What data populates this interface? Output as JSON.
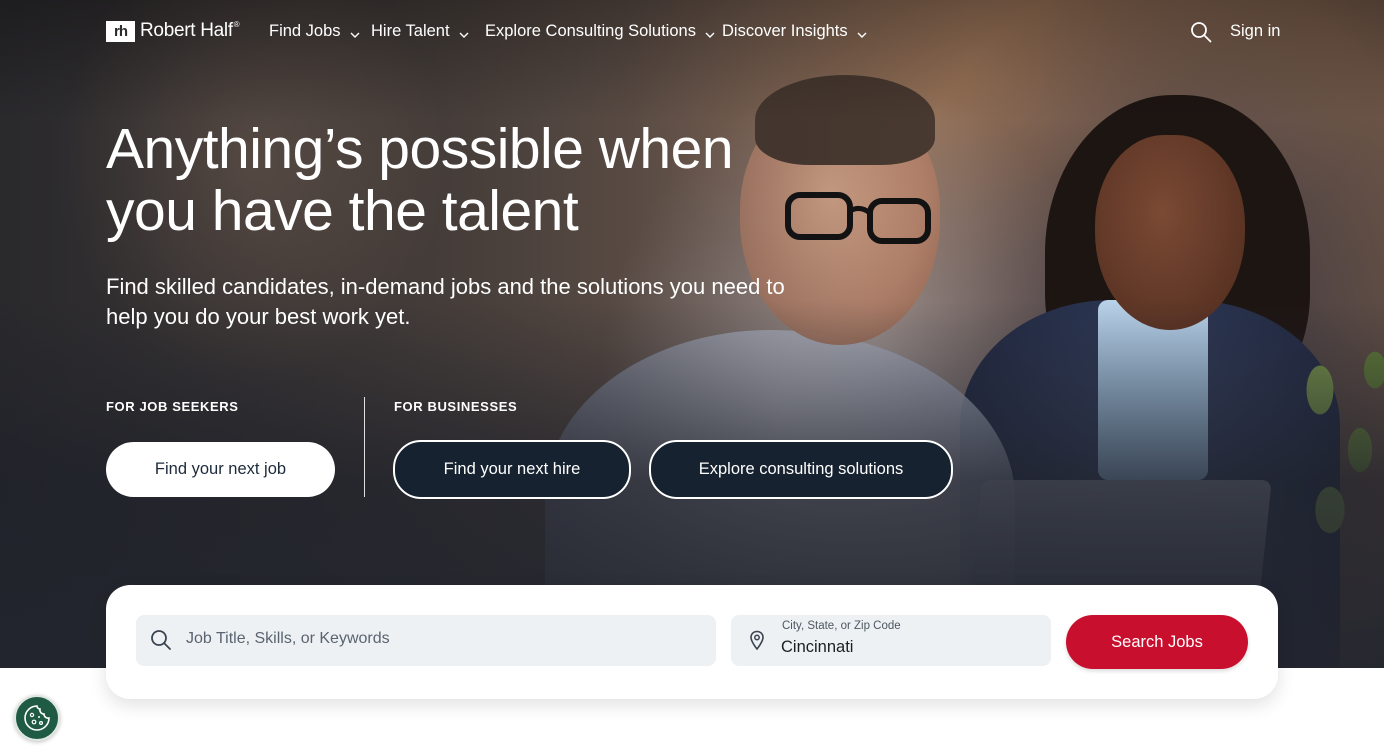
{
  "brand": {
    "name": "Robert Half",
    "mark": "rh",
    "trademark": "®"
  },
  "nav": {
    "items": [
      {
        "label": "Find Jobs"
      },
      {
        "label": "Hire Talent"
      },
      {
        "label": "Explore Consulting Solutions"
      },
      {
        "label": "Discover Insights"
      }
    ],
    "search_icon": "search-icon",
    "sign_in": "Sign in"
  },
  "hero": {
    "headline": "Anything’s possible when you have the talent",
    "subhead": "Find skilled candidates, in-demand jobs and the solutions you need to help you do your best work yet.",
    "job_seekers": {
      "label": "FOR JOB SEEKERS",
      "button": "Find your next job"
    },
    "businesses": {
      "label": "FOR BUSINESSES",
      "hire_button": "Find your next hire",
      "consulting_button": "Explore consulting solutions"
    }
  },
  "search": {
    "keyword_placeholder": "Job Title, Skills, or Keywords",
    "keyword_value": "",
    "location_label": "City, State, or Zip Code",
    "location_value": "Cincinnati",
    "submit": "Search Jobs"
  },
  "cookie": {
    "icon": "cookie-icon"
  },
  "colors": {
    "accent_red": "#c8102e",
    "dark_pill": "#16222f",
    "cookie_green": "#1f5a44",
    "field_bg": "#eef1f4"
  }
}
